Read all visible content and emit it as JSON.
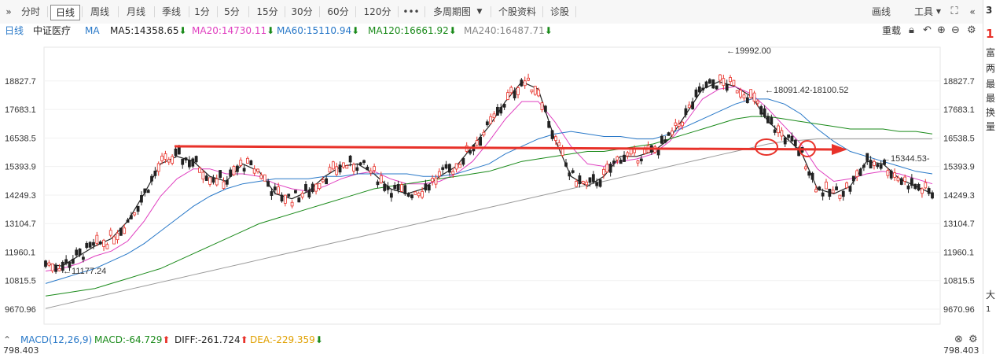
{
  "toolbar": {
    "collapse": "»",
    "periods": [
      "分时",
      "日线",
      "周线",
      "月线",
      "季线",
      "1分",
      "5分",
      "15分",
      "30分",
      "60分",
      "120分"
    ],
    "more": "•••",
    "multi_period": "多周期图",
    "stock_info": "个股资料",
    "diagnosis": "诊股",
    "draw_line": "画线",
    "tools": "工具",
    "right_collapse": "«"
  },
  "infobar": {
    "period": "日线",
    "index_name": "中证医疗",
    "ma_label": "MA",
    "ma5": "MA5:14358.65",
    "ma20": "MA20:14730.11",
    "ma60": "MA60:15110.94",
    "ma120": "MA120:16661.92",
    "ma240": "MA240:16487.71",
    "rehab": "重载",
    "colors": {
      "ma5": "#222222",
      "ma20": "#e040c0",
      "ma60": "#2878c8",
      "ma120": "#1a8a1a",
      "ma240": "#888888"
    }
  },
  "price_axis": [
    "18827.7",
    "17683.1",
    "16538.5",
    "15393.9",
    "14249.3",
    "13104.7",
    "11960.1",
    "10815.5",
    "9670.96"
  ],
  "annotations": {
    "high": "19992.00",
    "low": "11177.24",
    "mid": "18091.42-18100.52",
    "last": "15344.53"
  },
  "macd": {
    "label": "MACD(12,26,9)",
    "macd": "MACD:-64.729",
    "diff": "DIFF:-261.724",
    "dea": "DEA:-229.359",
    "axis_value": "798.403"
  },
  "right_panel": {
    "items": [
      "3",
      "1",
      "富",
      "两",
      "最",
      "最",
      "换",
      "量",
      "大",
      "1"
    ]
  },
  "chart_data": {
    "type": "candlestick",
    "ylim": [
      9670.96,
      19992
    ],
    "series": [
      {
        "name": "MA5",
        "values": [
          11500,
          11400,
          11800,
          12200,
          12500,
          13200,
          14300,
          15500,
          15800,
          15600,
          15000,
          14800,
          15500,
          15200,
          14300,
          14100,
          14400,
          15000,
          15400,
          15500,
          15100,
          14500,
          14300,
          14500,
          15000,
          15400,
          16200,
          17000,
          18000,
          18800,
          18500,
          16500,
          15000,
          14600,
          15000,
          15800,
          15800,
          16000,
          16500,
          17500,
          18500,
          18800,
          18600,
          18200,
          17200,
          16600,
          16000,
          14500,
          14300,
          14600,
          15600,
          15500,
          14900,
          14600,
          14300
        ]
      },
      {
        "name": "MA20",
        "values": [
          11200,
          11300,
          11500,
          11800,
          12000,
          12400,
          13200,
          14200,
          14900,
          15300,
          15300,
          15100,
          15100,
          15000,
          14700,
          14500,
          14400,
          14600,
          14900,
          15100,
          15200,
          14900,
          14700,
          14700,
          14800,
          15100,
          15600,
          16400,
          17300,
          18000,
          18000,
          17200,
          16200,
          15500,
          15400,
          15600,
          15700,
          15900,
          16400,
          17200,
          18100,
          18500,
          18600,
          18300,
          17700,
          17000,
          16300,
          15300,
          14800,
          14900,
          15100,
          15200,
          15100,
          14900,
          14700
        ]
      },
      {
        "name": "MA60",
        "values": [
          10700,
          10900,
          11100,
          11300,
          11600,
          11900,
          12300,
          12800,
          13300,
          13800,
          14200,
          14500,
          14700,
          14800,
          14900,
          14900,
          14900,
          15000,
          15000,
          15100,
          15100,
          15100,
          15100,
          15000,
          15000,
          15100,
          15300,
          15500,
          15900,
          16200,
          16500,
          16700,
          16800,
          16700,
          16600,
          16600,
          16500,
          16500,
          16700,
          17000,
          17300,
          17600,
          17900,
          18100,
          18100,
          17900,
          17500,
          16900,
          16400,
          16000,
          15800,
          15600,
          15400,
          15200,
          15100
        ]
      },
      {
        "name": "MA120",
        "values": [
          10200,
          10300,
          10400,
          10500,
          10700,
          10900,
          11100,
          11300,
          11600,
          11900,
          12200,
          12500,
          12800,
          13100,
          13300,
          13500,
          13700,
          13900,
          14100,
          14300,
          14500,
          14600,
          14700,
          14800,
          14900,
          15000,
          15100,
          15200,
          15400,
          15600,
          15700,
          15800,
          15900,
          16000,
          16000,
          16100,
          16200,
          16300,
          16500,
          16700,
          16900,
          17100,
          17300,
          17400,
          17400,
          17300,
          17200,
          17100,
          17000,
          16900,
          16900,
          16900,
          16800,
          16800,
          16700
        ]
      },
      {
        "name": "MA240",
        "values": [
          9700,
          9850,
          10000,
          10150,
          10300,
          10450,
          10600,
          10750,
          10900,
          11050,
          11200,
          11350,
          11500,
          11650,
          11800,
          11950,
          12100,
          12250,
          12400,
          12550,
          12700,
          12850,
          13000,
          13150,
          13300,
          13450,
          13600,
          13750,
          13900,
          14050,
          14200,
          14350,
          14500,
          14650,
          14800,
          14950,
          15100,
          15250,
          15400,
          15550,
          15700,
          15850,
          16000,
          16150,
          16300,
          16400,
          16450,
          16500,
          16500,
          16500,
          16500,
          16500,
          16500,
          16500,
          16500
        ]
      }
    ]
  }
}
